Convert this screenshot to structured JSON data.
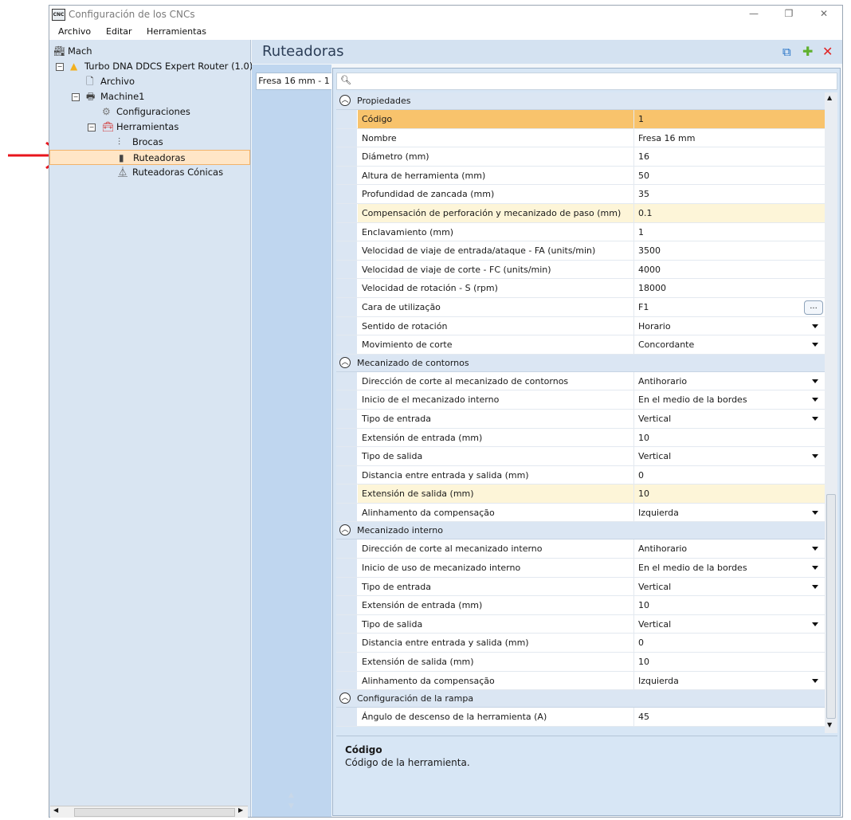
{
  "window": {
    "icon_text": "CNC",
    "title": "Configuración de los CNCs",
    "min_glyph": "—",
    "max_glyph": "❐",
    "close_glyph": "✕"
  },
  "menu": [
    "Archivo",
    "Editar",
    "Herramientas"
  ],
  "tree": {
    "items": [
      {
        "label": "Mach",
        "icon": "factory-icon",
        "level": 0,
        "expander": ""
      },
      {
        "label": "Turbo DNA DDCS Expert Router (1.0)",
        "icon": "warning-icon",
        "level": 1,
        "expander": "−"
      },
      {
        "label": "Archivo",
        "icon": "document-icon",
        "level": 2,
        "expander": ""
      },
      {
        "label": "Machine1",
        "icon": "machine-icon",
        "level": 2,
        "expander": "−"
      },
      {
        "label": "Configuraciones",
        "icon": "gear-icon",
        "level": 3,
        "expander": ""
      },
      {
        "label": "Herramientas",
        "icon": "toolbox-icon",
        "level": 3,
        "expander": "−"
      },
      {
        "label": "Brocas",
        "icon": "drill-bit-icon",
        "level": 4,
        "expander": ""
      },
      {
        "label": "Ruteadoras",
        "icon": "router-bit-icon",
        "level": 4,
        "expander": "",
        "selected": true
      },
      {
        "label": "Ruteadoras Cónicas",
        "icon": "conical-bit-icon",
        "level": 4,
        "expander": ""
      }
    ]
  },
  "header": {
    "title": "Ruteadoras",
    "actions": [
      {
        "name": "copy-icon",
        "glyph": "⧉",
        "color": "#1f6fc5"
      },
      {
        "name": "add-icon",
        "glyph": "✚",
        "color": "#5fb02d"
      },
      {
        "name": "delete-icon",
        "glyph": "✕",
        "color": "#e02424"
      }
    ]
  },
  "tabs": [
    {
      "label": "Fresa 16 mm - 1"
    }
  ],
  "search": {
    "icon": "search-icon",
    "value": ""
  },
  "categories": [
    {
      "label": "Propiedades",
      "rows": [
        {
          "name": "Código",
          "value": "1",
          "state": "selected"
        },
        {
          "name": "Nombre",
          "value": "Fresa 16 mm"
        },
        {
          "name": "Diámetro (mm)",
          "value": "16"
        },
        {
          "name": "Altura de herramienta (mm)",
          "value": "50"
        },
        {
          "name": "Profundidad de zancada (mm)",
          "value": "35"
        },
        {
          "name": "Compensación de perforación y mecanizado de paso (mm)",
          "value": "0.1",
          "state": "highlight"
        },
        {
          "name": "Enclavamiento (mm)",
          "value": "1"
        },
        {
          "name": "Velocidad de viaje de entrada/ataque - FA (units/min)",
          "value": "3500"
        },
        {
          "name": "Velocidad de viaje de corte - FC (units/min)",
          "value": "4000"
        },
        {
          "name": "Velocidad de rotación - S (rpm)",
          "value": "18000"
        },
        {
          "name": "Cara de utilização",
          "value": "F1",
          "editor": "ellipsis",
          "editor_label": "..."
        },
        {
          "name": "Sentido de rotación",
          "value": "Horario",
          "editor": "dropdown"
        },
        {
          "name": "Movimiento de corte",
          "value": "Concordante",
          "editor": "dropdown"
        }
      ]
    },
    {
      "label": "Mecanizado de contornos",
      "rows": [
        {
          "name": "Dirección de corte al mecanizado de contornos",
          "value": "Antihorario",
          "editor": "dropdown"
        },
        {
          "name": "Inicio de el mecanizado interno",
          "value": "En el medio de la bordes",
          "editor": "dropdown"
        },
        {
          "name": "Tipo de entrada",
          "value": "Vertical",
          "editor": "dropdown"
        },
        {
          "name": "Extensión de entrada (mm)",
          "value": "10"
        },
        {
          "name": "Tipo de salida",
          "value": "Vertical",
          "editor": "dropdown"
        },
        {
          "name": "Distancia entre entrada y salida (mm)",
          "value": "0"
        },
        {
          "name": "Extensión de salida (mm)",
          "value": "10",
          "state": "highlight"
        },
        {
          "name": "Alinhamento da compensação",
          "value": "Izquierda",
          "editor": "dropdown"
        }
      ]
    },
    {
      "label": "Mecanizado interno",
      "rows": [
        {
          "name": "Dirección de corte al mecanizado interno",
          "value": "Antihorario",
          "editor": "dropdown"
        },
        {
          "name": "Inicio de uso de mecanizado interno",
          "value": "En el medio de la bordes",
          "editor": "dropdown"
        },
        {
          "name": "Tipo de entrada",
          "value": "Vertical",
          "editor": "dropdown"
        },
        {
          "name": "Extensión de entrada (mm)",
          "value": "10"
        },
        {
          "name": "Tipo de salida",
          "value": "Vertical",
          "editor": "dropdown"
        },
        {
          "name": "Distancia entre entrada y salida (mm)",
          "value": "0"
        },
        {
          "name": "Extensión de salida (mm)",
          "value": "10"
        },
        {
          "name": "Alinhamento da compensação",
          "value": "Izquierda",
          "editor": "dropdown"
        }
      ]
    },
    {
      "label": "Configuración de la rampa",
      "rows": [
        {
          "name": "Ángulo de descenso de la herramienta (A)",
          "value": "45"
        }
      ]
    }
  ],
  "description": {
    "title": "Código",
    "text": "Código de la herramienta."
  },
  "colors": {
    "selection": "#f8c36c",
    "highlight": "#fdf5d8",
    "tree_bg": "#d9e5f2",
    "annotation_arrow": "#e8141c"
  }
}
